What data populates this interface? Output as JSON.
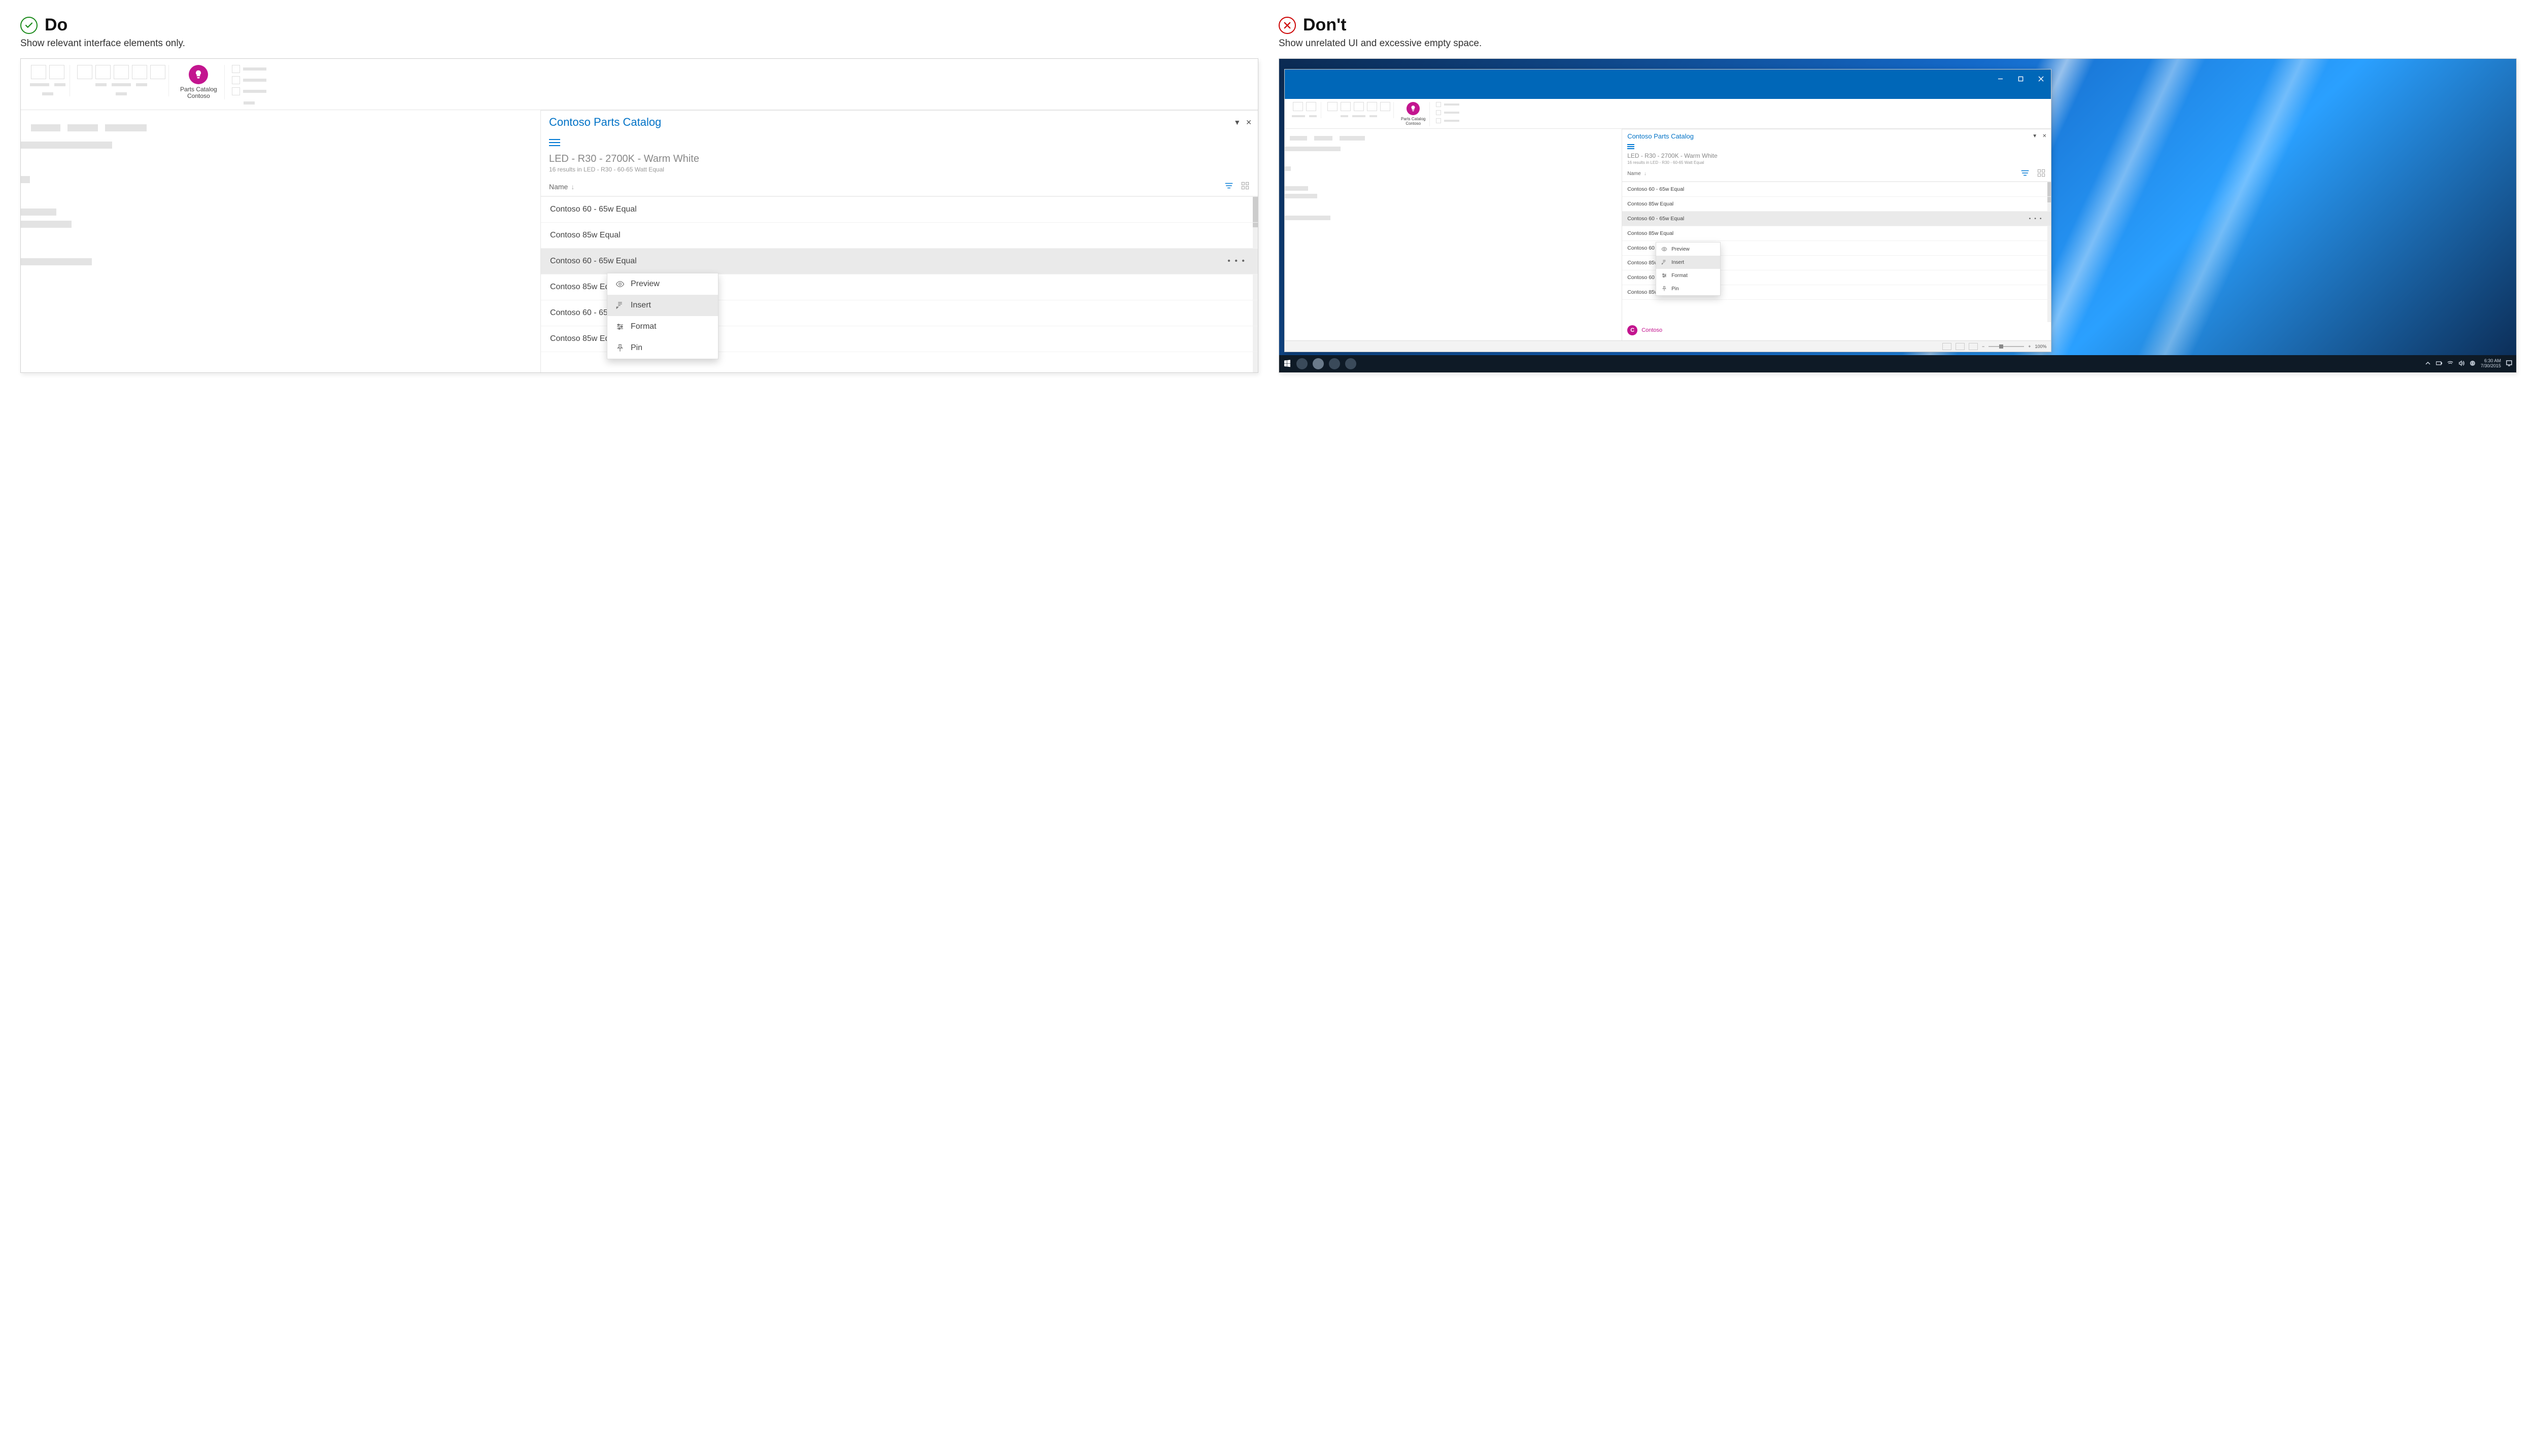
{
  "do": {
    "heading": "Do",
    "subtext": "Show relevant interface elements only."
  },
  "dont": {
    "heading": "Don't",
    "subtext": "Show unrelated UI and excessive empty space."
  },
  "ribbon": {
    "catalog_line1": "Parts Catalog",
    "catalog_line2": "Contoso"
  },
  "pane": {
    "title": "Contoso Parts Catalog",
    "search_main": "LED - R30 - 2700K - Warm White",
    "search_sub": "16 results in LED - R30 - 60-65 Watt Equal",
    "name_col": "Name",
    "items": [
      "Contoso 60 - 65w Equal",
      "Contoso 85w Equal",
      "Contoso 60 - 65w Equal",
      "Contoso 85w Equal",
      "Contoso 60 - 65w Equal",
      "Contoso 85w Equal",
      "Contoso 60 - 65w Equal",
      "Contoso 85w Equal"
    ],
    "selected_index": 2,
    "ctx": {
      "preview": "Preview",
      "insert": "Insert",
      "format": "Format",
      "pin": "Pin"
    }
  },
  "persona": {
    "initial": "C",
    "name": "Contoso"
  },
  "status": {
    "zoom": "100%",
    "plus": "+",
    "minus": "−"
  },
  "taskbar": {
    "time": "6:30 AM",
    "date": "7/30/2015"
  }
}
